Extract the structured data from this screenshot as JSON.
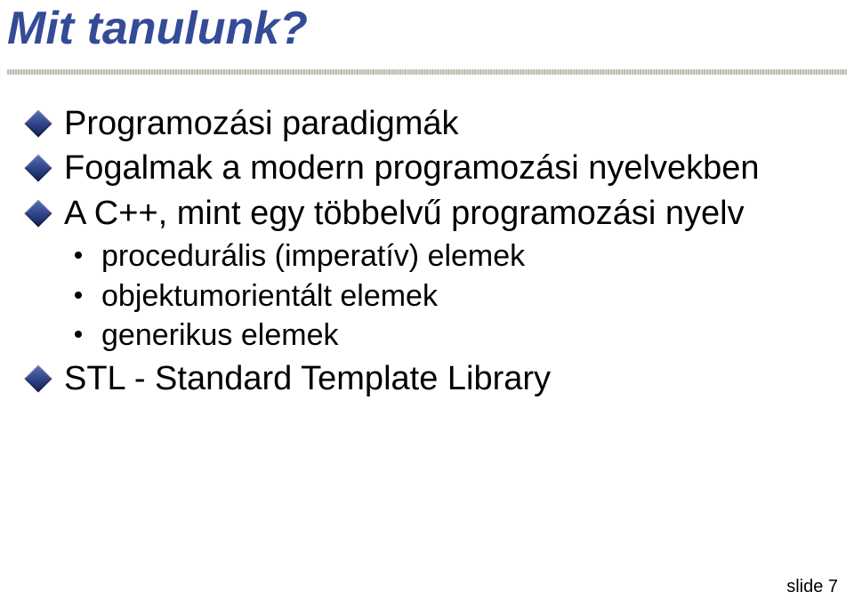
{
  "title": "Mit tanulunk?",
  "bullets": {
    "b1": "Programozási paradigmák",
    "b2": "Fogalmak a modern programozási nyelvekben",
    "b3": "A C++, mint egy többelvű programozási nyelv",
    "b3_sub": {
      "s1": "procedurális (imperatív) elemek",
      "s2": "objektumorientált elemek",
      "s3": "generikus elemek"
    },
    "b4": "STL - Standard Template Library"
  },
  "footer": "slide 7"
}
